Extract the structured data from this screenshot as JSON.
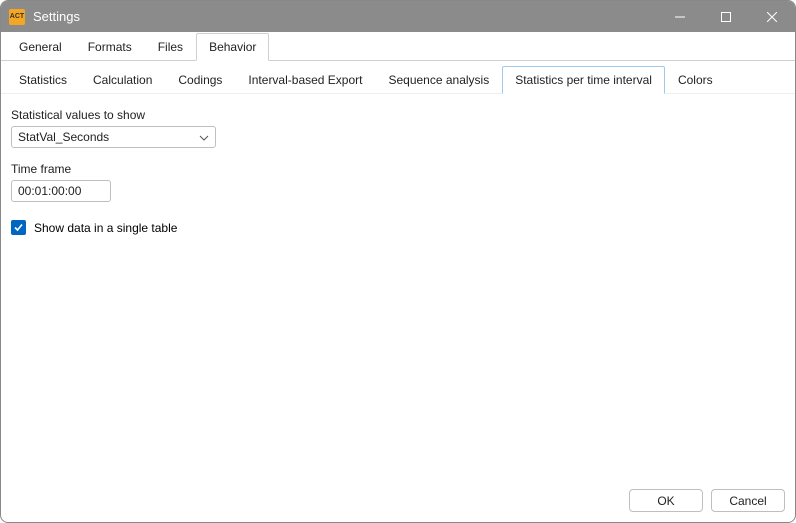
{
  "window": {
    "title": "Settings"
  },
  "tabs": {
    "general": "General",
    "formats": "Formats",
    "files": "Files",
    "behavior": "Behavior"
  },
  "subtabs": {
    "statistics": "Statistics",
    "calculation": "Calculation",
    "codings": "Codings",
    "interval_export": "Interval-based Export",
    "sequence_analysis": "Sequence analysis",
    "stats_per_time": "Statistics per time interval",
    "colors": "Colors"
  },
  "form": {
    "stat_values_label": "Statistical values to show",
    "stat_values_selected": "StatVal_Seconds",
    "time_frame_label": "Time frame",
    "time_frame_value": "00:01:00:00",
    "single_table_label": "Show data in a single table"
  },
  "buttons": {
    "ok": "OK",
    "cancel": "Cancel"
  }
}
